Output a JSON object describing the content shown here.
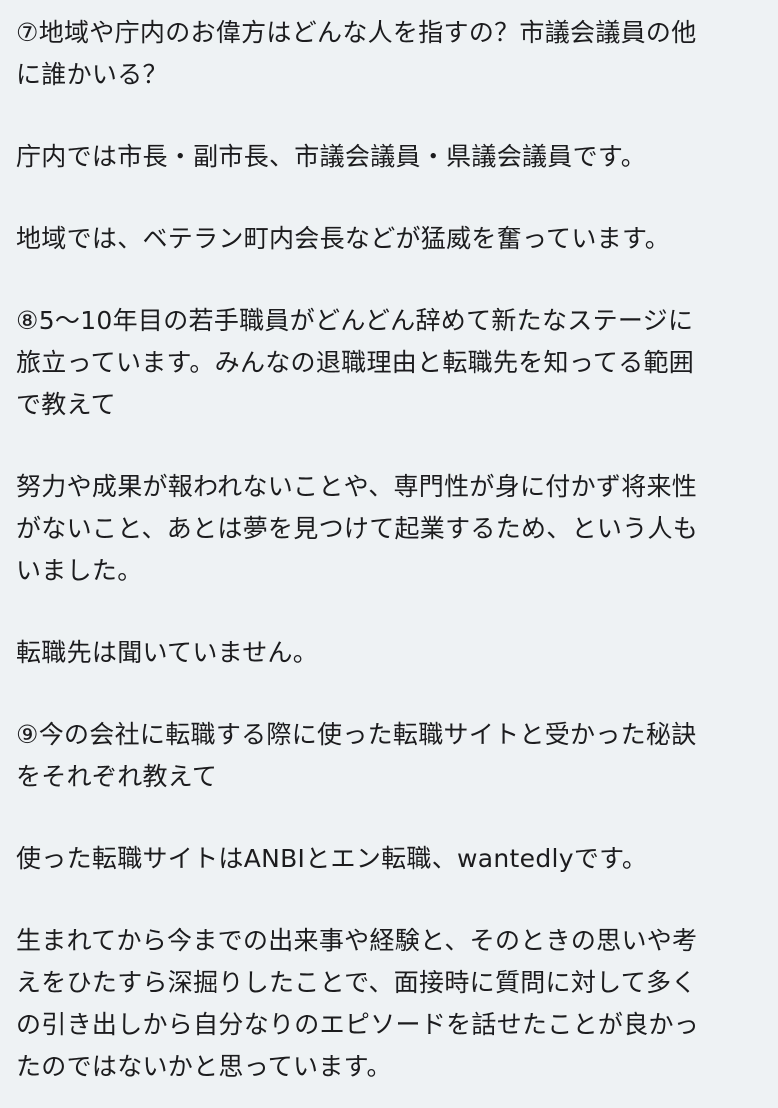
{
  "paragraphs": [
    {
      "name": "question-7",
      "lines": [
        "⑦地域や庁内のお偉方はどんな人を指すの？市議会議員の他",
        "に誰かいる？"
      ]
    },
    {
      "name": "answer-7-office",
      "lines": [
        "庁内では市長・副市長、市議会議員・県議会議員です。"
      ]
    },
    {
      "name": "answer-7-region",
      "lines": [
        "地域では、ベテラン町内会長などが猛威を奮っています。"
      ]
    },
    {
      "name": "question-8",
      "lines": [
        "⑧5〜10年目の若手職員がどんどん辞めて新たなステージに",
        "旅立っています。みんなの退職理由と転職先を知ってる範囲",
        "で教えて"
      ]
    },
    {
      "name": "answer-8-reasons",
      "lines": [
        "努力や成果が報われないことや、専門性が身に付かず将来性",
        "がないこと、あとは夢を見つけて起業するため、という人も",
        "いました。"
      ]
    },
    {
      "name": "answer-8-destination",
      "lines": [
        "転職先は聞いていません。"
      ]
    },
    {
      "name": "question-9",
      "lines": [
        "⑨今の会社に転職する際に使った転職サイトと受かった秘訣",
        "をそれぞれ教えて"
      ]
    },
    {
      "name": "answer-9-sites",
      "lines": [
        "使った転職サイトはANBIとエン転職、wantedlyです。"
      ]
    },
    {
      "name": "answer-9-secret",
      "lines": [
        "生まれてから今までの出来事や経験と、そのときの思いや考",
        "えをひたすら深掘りしたことで、面接時に質問に対して多く",
        "の引き出しから自分なりのエピソードを話せたことが良かっ",
        "たのではないかと思っています。"
      ]
    }
  ]
}
